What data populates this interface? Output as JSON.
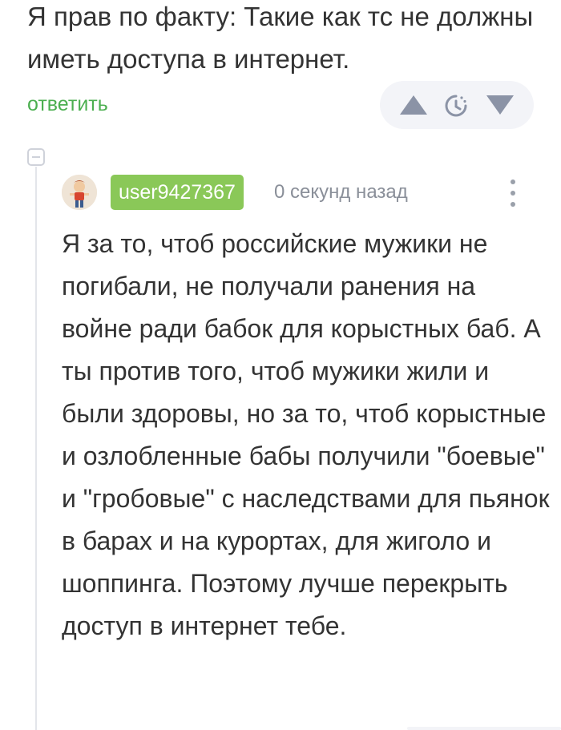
{
  "parent_comment": {
    "text": "Я прав по факту: Такие как тс не должны иметь доступа в интернет.",
    "reply_label": "ответить"
  },
  "votes": {
    "up_icon": "triangle-up-icon",
    "rating_icon": "clock-icon",
    "down_icon": "triangle-down-icon",
    "icon_color": "#8b93a6"
  },
  "comment": {
    "username": "user9427367",
    "timestamp": "0 секунд назад",
    "text": "Я за то, чтоб российские мужики не погибали, не получали ранения на войне ради бабок для корыстных баб. А ты против того, чтоб мужики жили и были здоровы, но за то, чтоб корыстные и озлобленные бабы получили \"боевые\" и \"гробовые\" с наследствами для пьянок в барах и на курортах, для жиголо и шоппинга. Поэтому лучше перекрыть доступ в интернет тебе.",
    "username_bg": "#8ac858"
  },
  "colors": {
    "accent": "#4caf50",
    "text": "#333333",
    "muted": "#8a8f99"
  }
}
